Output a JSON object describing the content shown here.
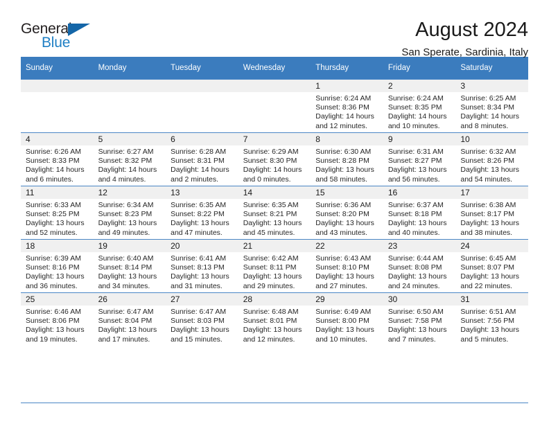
{
  "brand": {
    "name_part1": "General",
    "name_part2": "Blue",
    "logo_icon": "triangle-flag-icon",
    "accent_color": "#1f7fc4"
  },
  "header": {
    "title": "August 2024",
    "subtitle": "San Sperate, Sardinia, Italy"
  },
  "calendar": {
    "header_bg": "#3b7cbe",
    "daynum_bg": "#f0f0f0",
    "weekday_headers": [
      "Sunday",
      "Monday",
      "Tuesday",
      "Wednesday",
      "Thursday",
      "Friday",
      "Saturday"
    ],
    "weeks": [
      [
        {
          "day": "",
          "sunrise": "",
          "sunset": "",
          "daylight_line1": "",
          "daylight_line2": ""
        },
        {
          "day": "",
          "sunrise": "",
          "sunset": "",
          "daylight_line1": "",
          "daylight_line2": ""
        },
        {
          "day": "",
          "sunrise": "",
          "sunset": "",
          "daylight_line1": "",
          "daylight_line2": ""
        },
        {
          "day": "",
          "sunrise": "",
          "sunset": "",
          "daylight_line1": "",
          "daylight_line2": ""
        },
        {
          "day": "1",
          "sunrise": "Sunrise: 6:24 AM",
          "sunset": "Sunset: 8:36 PM",
          "daylight_line1": "Daylight: 14 hours",
          "daylight_line2": "and 12 minutes."
        },
        {
          "day": "2",
          "sunrise": "Sunrise: 6:24 AM",
          "sunset": "Sunset: 8:35 PM",
          "daylight_line1": "Daylight: 14 hours",
          "daylight_line2": "and 10 minutes."
        },
        {
          "day": "3",
          "sunrise": "Sunrise: 6:25 AM",
          "sunset": "Sunset: 8:34 PM",
          "daylight_line1": "Daylight: 14 hours",
          "daylight_line2": "and 8 minutes."
        }
      ],
      [
        {
          "day": "4",
          "sunrise": "Sunrise: 6:26 AM",
          "sunset": "Sunset: 8:33 PM",
          "daylight_line1": "Daylight: 14 hours",
          "daylight_line2": "and 6 minutes."
        },
        {
          "day": "5",
          "sunrise": "Sunrise: 6:27 AM",
          "sunset": "Sunset: 8:32 PM",
          "daylight_line1": "Daylight: 14 hours",
          "daylight_line2": "and 4 minutes."
        },
        {
          "day": "6",
          "sunrise": "Sunrise: 6:28 AM",
          "sunset": "Sunset: 8:31 PM",
          "daylight_line1": "Daylight: 14 hours",
          "daylight_line2": "and 2 minutes."
        },
        {
          "day": "7",
          "sunrise": "Sunrise: 6:29 AM",
          "sunset": "Sunset: 8:30 PM",
          "daylight_line1": "Daylight: 14 hours",
          "daylight_line2": "and 0 minutes."
        },
        {
          "day": "8",
          "sunrise": "Sunrise: 6:30 AM",
          "sunset": "Sunset: 8:28 PM",
          "daylight_line1": "Daylight: 13 hours",
          "daylight_line2": "and 58 minutes."
        },
        {
          "day": "9",
          "sunrise": "Sunrise: 6:31 AM",
          "sunset": "Sunset: 8:27 PM",
          "daylight_line1": "Daylight: 13 hours",
          "daylight_line2": "and 56 minutes."
        },
        {
          "day": "10",
          "sunrise": "Sunrise: 6:32 AM",
          "sunset": "Sunset: 8:26 PM",
          "daylight_line1": "Daylight: 13 hours",
          "daylight_line2": "and 54 minutes."
        }
      ],
      [
        {
          "day": "11",
          "sunrise": "Sunrise: 6:33 AM",
          "sunset": "Sunset: 8:25 PM",
          "daylight_line1": "Daylight: 13 hours",
          "daylight_line2": "and 52 minutes."
        },
        {
          "day": "12",
          "sunrise": "Sunrise: 6:34 AM",
          "sunset": "Sunset: 8:23 PM",
          "daylight_line1": "Daylight: 13 hours",
          "daylight_line2": "and 49 minutes."
        },
        {
          "day": "13",
          "sunrise": "Sunrise: 6:35 AM",
          "sunset": "Sunset: 8:22 PM",
          "daylight_line1": "Daylight: 13 hours",
          "daylight_line2": "and 47 minutes."
        },
        {
          "day": "14",
          "sunrise": "Sunrise: 6:35 AM",
          "sunset": "Sunset: 8:21 PM",
          "daylight_line1": "Daylight: 13 hours",
          "daylight_line2": "and 45 minutes."
        },
        {
          "day": "15",
          "sunrise": "Sunrise: 6:36 AM",
          "sunset": "Sunset: 8:20 PM",
          "daylight_line1": "Daylight: 13 hours",
          "daylight_line2": "and 43 minutes."
        },
        {
          "day": "16",
          "sunrise": "Sunrise: 6:37 AM",
          "sunset": "Sunset: 8:18 PM",
          "daylight_line1": "Daylight: 13 hours",
          "daylight_line2": "and 40 minutes."
        },
        {
          "day": "17",
          "sunrise": "Sunrise: 6:38 AM",
          "sunset": "Sunset: 8:17 PM",
          "daylight_line1": "Daylight: 13 hours",
          "daylight_line2": "and 38 minutes."
        }
      ],
      [
        {
          "day": "18",
          "sunrise": "Sunrise: 6:39 AM",
          "sunset": "Sunset: 8:16 PM",
          "daylight_line1": "Daylight: 13 hours",
          "daylight_line2": "and 36 minutes."
        },
        {
          "day": "19",
          "sunrise": "Sunrise: 6:40 AM",
          "sunset": "Sunset: 8:14 PM",
          "daylight_line1": "Daylight: 13 hours",
          "daylight_line2": "and 34 minutes."
        },
        {
          "day": "20",
          "sunrise": "Sunrise: 6:41 AM",
          "sunset": "Sunset: 8:13 PM",
          "daylight_line1": "Daylight: 13 hours",
          "daylight_line2": "and 31 minutes."
        },
        {
          "day": "21",
          "sunrise": "Sunrise: 6:42 AM",
          "sunset": "Sunset: 8:11 PM",
          "daylight_line1": "Daylight: 13 hours",
          "daylight_line2": "and 29 minutes."
        },
        {
          "day": "22",
          "sunrise": "Sunrise: 6:43 AM",
          "sunset": "Sunset: 8:10 PM",
          "daylight_line1": "Daylight: 13 hours",
          "daylight_line2": "and 27 minutes."
        },
        {
          "day": "23",
          "sunrise": "Sunrise: 6:44 AM",
          "sunset": "Sunset: 8:08 PM",
          "daylight_line1": "Daylight: 13 hours",
          "daylight_line2": "and 24 minutes."
        },
        {
          "day": "24",
          "sunrise": "Sunrise: 6:45 AM",
          "sunset": "Sunset: 8:07 PM",
          "daylight_line1": "Daylight: 13 hours",
          "daylight_line2": "and 22 minutes."
        }
      ],
      [
        {
          "day": "25",
          "sunrise": "Sunrise: 6:46 AM",
          "sunset": "Sunset: 8:06 PM",
          "daylight_line1": "Daylight: 13 hours",
          "daylight_line2": "and 19 minutes."
        },
        {
          "day": "26",
          "sunrise": "Sunrise: 6:47 AM",
          "sunset": "Sunset: 8:04 PM",
          "daylight_line1": "Daylight: 13 hours",
          "daylight_line2": "and 17 minutes."
        },
        {
          "day": "27",
          "sunrise": "Sunrise: 6:47 AM",
          "sunset": "Sunset: 8:03 PM",
          "daylight_line1": "Daylight: 13 hours",
          "daylight_line2": "and 15 minutes."
        },
        {
          "day": "28",
          "sunrise": "Sunrise: 6:48 AM",
          "sunset": "Sunset: 8:01 PM",
          "daylight_line1": "Daylight: 13 hours",
          "daylight_line2": "and 12 minutes."
        },
        {
          "day": "29",
          "sunrise": "Sunrise: 6:49 AM",
          "sunset": "Sunset: 8:00 PM",
          "daylight_line1": "Daylight: 13 hours",
          "daylight_line2": "and 10 minutes."
        },
        {
          "day": "30",
          "sunrise": "Sunrise: 6:50 AM",
          "sunset": "Sunset: 7:58 PM",
          "daylight_line1": "Daylight: 13 hours",
          "daylight_line2": "and 7 minutes."
        },
        {
          "day": "31",
          "sunrise": "Sunrise: 6:51 AM",
          "sunset": "Sunset: 7:56 PM",
          "daylight_line1": "Daylight: 13 hours",
          "daylight_line2": "and 5 minutes."
        }
      ]
    ]
  }
}
